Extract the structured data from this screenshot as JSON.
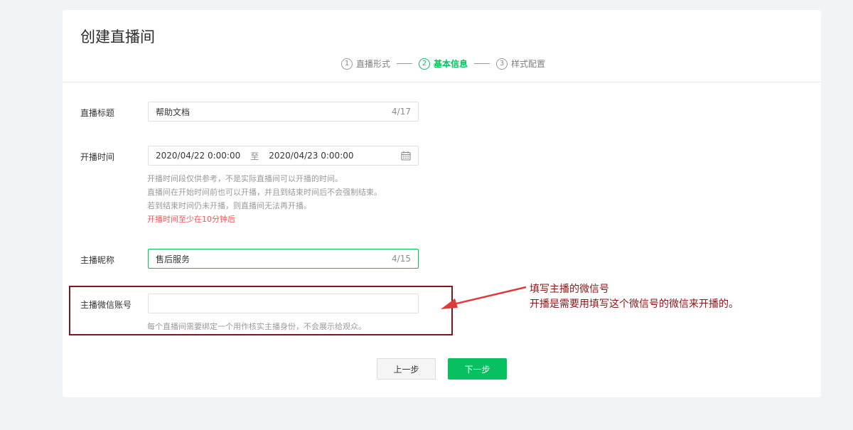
{
  "page": {
    "title": "创建直播间"
  },
  "steps": [
    {
      "num": "1",
      "label": "直播形式",
      "active": false
    },
    {
      "num": "2",
      "label": "基本信息",
      "active": true
    },
    {
      "num": "3",
      "label": "样式配置",
      "active": false
    }
  ],
  "form": {
    "title_field": {
      "label": "直播标题",
      "value": "帮助文档",
      "counter": "4/17"
    },
    "time_field": {
      "label": "开播时间",
      "start": "2020/04/22 0:00:00",
      "separator": "至",
      "end": "2020/04/23 0:00:00",
      "hints": [
        "开播时间段仅供参考，不是实际直播间可以开播的时间。",
        "直播间在开始时间前也可以开播，并且到结束时间后不会强制结束。",
        "若到结束时间仍未开播，则直播间无法再开播。"
      ],
      "warning": "开播时间至少在10分钟后"
    },
    "nickname_field": {
      "label": "主播昵称",
      "value": "售后服务",
      "counter": "4/15"
    },
    "wechat_field": {
      "label": "主播微信账号",
      "value": "",
      "hint": "每个直播间需要绑定一个用作核实主播身份，不会展示给观众。"
    }
  },
  "buttons": {
    "prev": "上一步",
    "next": "下一步"
  },
  "annotation": {
    "line1": "填写主播的微信号",
    "line2": "开播是需要用填写这个微信号的微信来开播的。"
  },
  "colors": {
    "accent": "#07c160",
    "warning": "#fa5151",
    "annotation": "#8b1414"
  }
}
